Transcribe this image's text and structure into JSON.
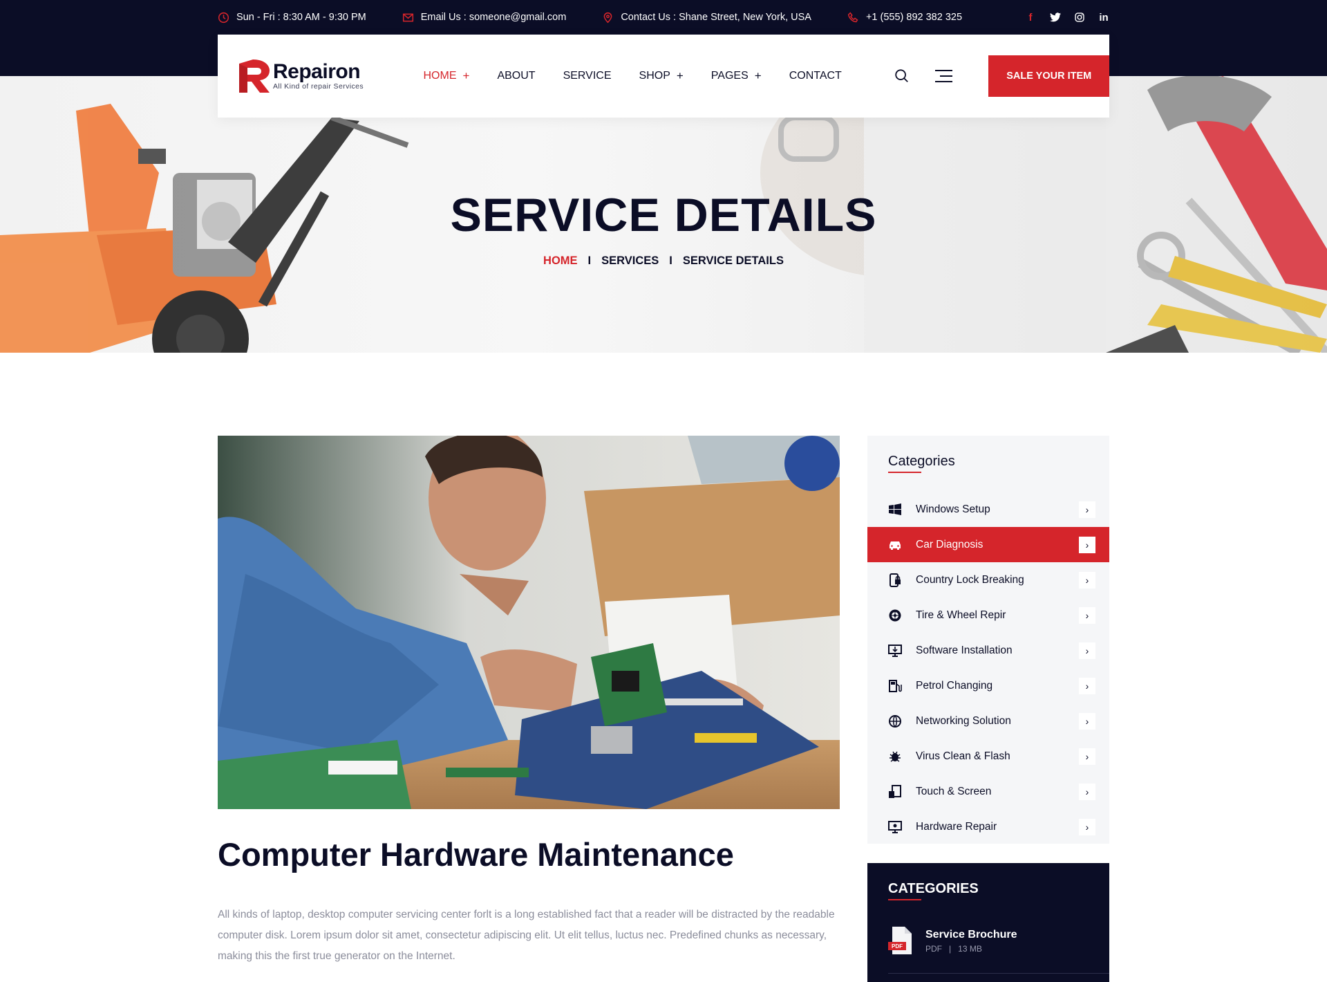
{
  "topbar": {
    "hours": "Sun - Fri : 8:30 AM - 9:30 PM",
    "email": "Email Us : someone@gmail.com",
    "address": "Contact Us : Shane Street, New York, USA",
    "phone": "+1 (555) 892 382 325",
    "social": {
      "facebook": "f",
      "twitter": "t",
      "instagram": "o",
      "linkedin": "in"
    }
  },
  "header": {
    "logo_name": "Repairon",
    "logo_tagline": "All Kind of repair Services",
    "nav": [
      {
        "label": "HOME",
        "has_submenu": "+"
      },
      {
        "label": "ABOUT"
      },
      {
        "label": "SERVICE"
      },
      {
        "label": "SHOP",
        "has_submenu": "+"
      },
      {
        "label": "PAGES",
        "has_submenu": "+"
      },
      {
        "label": "CONTACT"
      }
    ],
    "cta": "SALE YOUR ITEM"
  },
  "hero": {
    "title": "SERVICE DETAILS",
    "breadcrumb": [
      "HOME",
      "SERVICES",
      "SERVICE DETAILS"
    ]
  },
  "article": {
    "title": "Computer Hardware Maintenance",
    "body": "All kinds of laptop, desktop computer servicing center forlt is a long established fact that a reader will be distracted by the readable computer disk. Lorem ipsum dolor sit amet, consectetur adipiscing elit. Ut elit tellus, luctus nec. Predefined chunks as necessary, making this the first true generator on the Internet."
  },
  "sidebar": {
    "categories_title": "Categories",
    "categories": [
      {
        "label": "Windows Setup",
        "icon": "windows-icon"
      },
      {
        "label": "Car Diagnosis",
        "icon": "car-icon"
      },
      {
        "label": "Country Lock Breaking",
        "icon": "phone-lock-icon"
      },
      {
        "label": "Tire & Wheel Repir",
        "icon": "tire-icon"
      },
      {
        "label": "Software Installation",
        "icon": "monitor-download-icon"
      },
      {
        "label": "Petrol Changing",
        "icon": "petrol-icon"
      },
      {
        "label": "Networking Solution",
        "icon": "network-icon"
      },
      {
        "label": "Virus Clean & Flash",
        "icon": "virus-icon"
      },
      {
        "label": "Touch & Screen",
        "icon": "touch-screen-icon"
      },
      {
        "label": "Hardware Repair",
        "icon": "hardware-monitor-icon"
      }
    ],
    "downloads_title": "CATEGORIES",
    "download": {
      "name": "Service Brochure",
      "type": "PDF",
      "size": "13 MB",
      "badge": "PDF"
    }
  },
  "colors": {
    "accent": "#d5252b",
    "dark": "#0b0d26",
    "muted": "#8b8d9b"
  }
}
